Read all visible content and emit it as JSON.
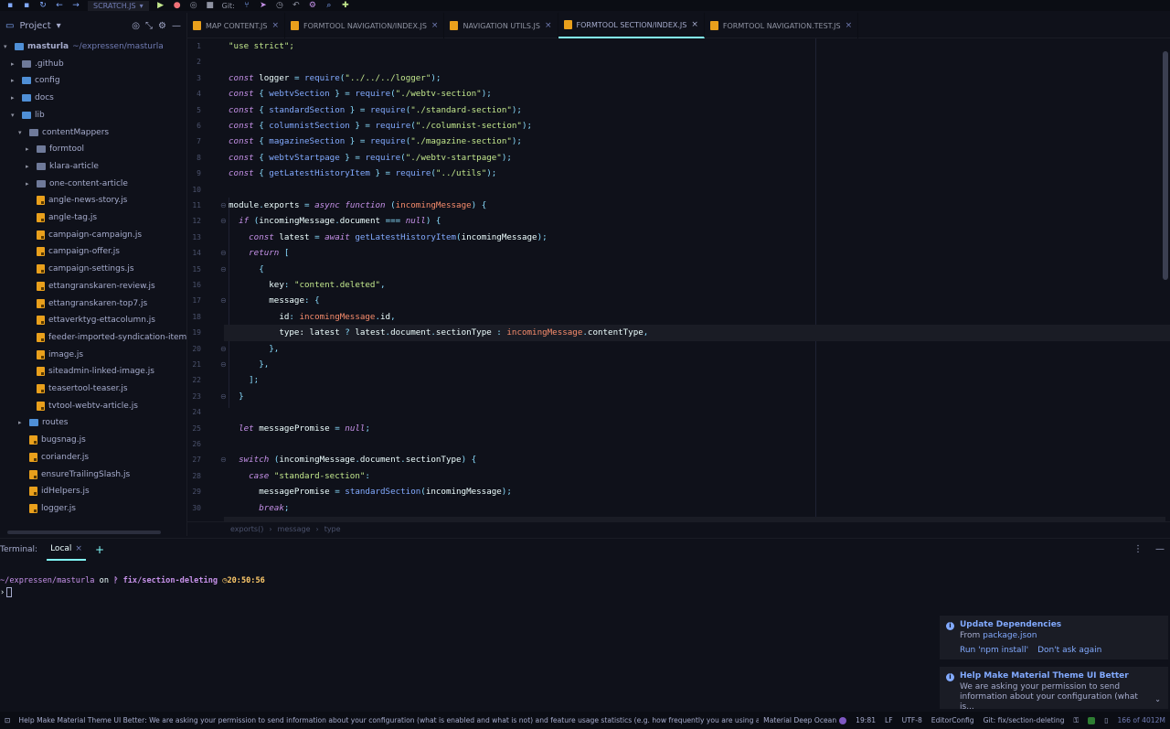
{
  "toolbar": {
    "run_config": "SCRATCH.JS",
    "git_label": "Git:"
  },
  "project": {
    "title": "Project",
    "tree": [
      {
        "label": "masturla",
        "suffix": "~/expressen/masturla",
        "type": "root",
        "depth": 0,
        "expanded": true
      },
      {
        "label": ".github",
        "type": "folder",
        "depth": 1,
        "expanded": false
      },
      {
        "label": "config",
        "type": "folder-blue",
        "depth": 1,
        "expanded": false
      },
      {
        "label": "docs",
        "type": "folder-blue",
        "depth": 1,
        "expanded": false
      },
      {
        "label": "lib",
        "type": "folder-blue",
        "depth": 1,
        "expanded": true
      },
      {
        "label": "contentMappers",
        "type": "folder",
        "depth": 2,
        "expanded": true
      },
      {
        "label": "formtool",
        "type": "folder",
        "depth": 3,
        "expanded": false
      },
      {
        "label": "klara-article",
        "type": "folder",
        "depth": 3,
        "expanded": false
      },
      {
        "label": "one-content-article",
        "type": "folder",
        "depth": 3,
        "expanded": false
      },
      {
        "label": "angle-news-story.js",
        "type": "js",
        "depth": 3
      },
      {
        "label": "angle-tag.js",
        "type": "js",
        "depth": 3
      },
      {
        "label": "campaign-campaign.js",
        "type": "js",
        "depth": 3
      },
      {
        "label": "campaign-offer.js",
        "type": "js",
        "depth": 3
      },
      {
        "label": "campaign-settings.js",
        "type": "js",
        "depth": 3
      },
      {
        "label": "ettangranskaren-review.js",
        "type": "js",
        "depth": 3
      },
      {
        "label": "ettangranskaren-top7.js",
        "type": "js",
        "depth": 3
      },
      {
        "label": "ettaverktyg-ettacolumn.js",
        "type": "js",
        "depth": 3
      },
      {
        "label": "feeder-imported-syndication-item.js",
        "type": "js",
        "depth": 3
      },
      {
        "label": "image.js",
        "type": "js",
        "depth": 3
      },
      {
        "label": "siteadmin-linked-image.js",
        "type": "js",
        "depth": 3
      },
      {
        "label": "teasertool-teaser.js",
        "type": "js",
        "depth": 3
      },
      {
        "label": "tvtool-webtv-article.js",
        "type": "js",
        "depth": 3
      },
      {
        "label": "routes",
        "type": "folder-blue",
        "depth": 2,
        "expanded": false
      },
      {
        "label": "bugsnag.js",
        "type": "js",
        "depth": 2
      },
      {
        "label": "coriander.js",
        "type": "js",
        "depth": 2
      },
      {
        "label": "ensureTrailingSlash.js",
        "type": "js",
        "depth": 2
      },
      {
        "label": "idHelpers.js",
        "type": "js",
        "depth": 2
      },
      {
        "label": "logger.js",
        "type": "js",
        "depth": 2
      }
    ]
  },
  "tabs": [
    {
      "label": "MAP CONTENT.JS",
      "active": false
    },
    {
      "label": "FORMTOOL NAVIGATION/INDEX.JS",
      "active": false
    },
    {
      "label": "NAVIGATION UTILS.JS",
      "active": false
    },
    {
      "label": "FORMTOOL SECTION/INDEX.JS",
      "active": true
    },
    {
      "label": "FORMTOOL NAVIGATION.TEST.JS",
      "active": false
    }
  ],
  "editor": {
    "highlighted_line": 19,
    "lines": [
      [
        [
          "\"use strict\";",
          "str"
        ]
      ],
      [],
      [
        [
          "const",
          "kw"
        ],
        [
          " logger ",
          "plain"
        ],
        [
          "=",
          "op"
        ],
        [
          " ",
          "plain"
        ],
        [
          "require",
          "fn"
        ],
        [
          "(",
          "punc"
        ],
        [
          "\"../../../logger\"",
          "str"
        ],
        [
          ");",
          "punc"
        ]
      ],
      [
        [
          "const",
          "kw"
        ],
        [
          " { ",
          "punc"
        ],
        [
          "webtvSection",
          "fn"
        ],
        [
          " } ",
          "punc"
        ],
        [
          "=",
          "op"
        ],
        [
          " ",
          "plain"
        ],
        [
          "require",
          "fn"
        ],
        [
          "(",
          "punc"
        ],
        [
          "\"./webtv-section\"",
          "str"
        ],
        [
          ");",
          "punc"
        ]
      ],
      [
        [
          "const",
          "kw"
        ],
        [
          " { ",
          "punc"
        ],
        [
          "standardSection",
          "fn"
        ],
        [
          " } ",
          "punc"
        ],
        [
          "=",
          "op"
        ],
        [
          " ",
          "plain"
        ],
        [
          "require",
          "fn"
        ],
        [
          "(",
          "punc"
        ],
        [
          "\"./standard-section\"",
          "str"
        ],
        [
          ");",
          "punc"
        ]
      ],
      [
        [
          "const",
          "kw"
        ],
        [
          " { ",
          "punc"
        ],
        [
          "columnistSection",
          "fn"
        ],
        [
          " } ",
          "punc"
        ],
        [
          "=",
          "op"
        ],
        [
          " ",
          "plain"
        ],
        [
          "require",
          "fn"
        ],
        [
          "(",
          "punc"
        ],
        [
          "\"./columnist-section\"",
          "str"
        ],
        [
          ");",
          "punc"
        ]
      ],
      [
        [
          "const",
          "kw"
        ],
        [
          " { ",
          "punc"
        ],
        [
          "magazineSection",
          "fn"
        ],
        [
          " } ",
          "punc"
        ],
        [
          "=",
          "op"
        ],
        [
          " ",
          "plain"
        ],
        [
          "require",
          "fn"
        ],
        [
          "(",
          "punc"
        ],
        [
          "\"./magazine-section\"",
          "str"
        ],
        [
          ");",
          "punc"
        ]
      ],
      [
        [
          "const",
          "kw"
        ],
        [
          " { ",
          "punc"
        ],
        [
          "webtvStartpage",
          "fn"
        ],
        [
          " } ",
          "punc"
        ],
        [
          "=",
          "op"
        ],
        [
          " ",
          "plain"
        ],
        [
          "require",
          "fn"
        ],
        [
          "(",
          "punc"
        ],
        [
          "\"./webtv-startpage\"",
          "str"
        ],
        [
          ");",
          "punc"
        ]
      ],
      [
        [
          "const",
          "kw"
        ],
        [
          " { ",
          "punc"
        ],
        [
          "getLatestHistoryItem",
          "fn"
        ],
        [
          " } ",
          "punc"
        ],
        [
          "=",
          "op"
        ],
        [
          " ",
          "plain"
        ],
        [
          "require",
          "fn"
        ],
        [
          "(",
          "punc"
        ],
        [
          "\"../utils\"",
          "str"
        ],
        [
          ");",
          "punc"
        ]
      ],
      [],
      [
        [
          "module",
          "plain"
        ],
        [
          ".",
          "punc"
        ],
        [
          "exports",
          "plain"
        ],
        [
          " = ",
          "op"
        ],
        [
          "async",
          "kw"
        ],
        [
          " ",
          "plain"
        ],
        [
          "function",
          "kw"
        ],
        [
          " (",
          "punc"
        ],
        [
          "incomingMessage",
          "var"
        ],
        [
          ") {",
          "punc"
        ]
      ],
      [
        [
          "  ",
          "plain"
        ],
        [
          "if",
          "kw"
        ],
        [
          " (",
          "punc"
        ],
        [
          "incomingMessage",
          "plain"
        ],
        [
          ".",
          "punc"
        ],
        [
          "document",
          "plain"
        ],
        [
          " === ",
          "op"
        ],
        [
          "null",
          "kw"
        ],
        [
          ") {",
          "punc"
        ]
      ],
      [
        [
          "    ",
          "plain"
        ],
        [
          "const",
          "kw"
        ],
        [
          " latest ",
          "plain"
        ],
        [
          "=",
          "op"
        ],
        [
          " ",
          "plain"
        ],
        [
          "await",
          "kw"
        ],
        [
          " ",
          "plain"
        ],
        [
          "getLatestHistoryItem",
          "fn"
        ],
        [
          "(",
          "punc"
        ],
        [
          "incomingMessage",
          "plain"
        ],
        [
          ");",
          "punc"
        ]
      ],
      [
        [
          "    ",
          "plain"
        ],
        [
          "return",
          "kw"
        ],
        [
          " [",
          "punc"
        ]
      ],
      [
        [
          "      ",
          "plain"
        ],
        [
          "{",
          "punc"
        ]
      ],
      [
        [
          "        ",
          "plain"
        ],
        [
          "key",
          "plain"
        ],
        [
          ": ",
          "punc"
        ],
        [
          "\"content.deleted\"",
          "str"
        ],
        [
          ",",
          "punc"
        ]
      ],
      [
        [
          "        ",
          "plain"
        ],
        [
          "message",
          "plain"
        ],
        [
          ": {",
          "punc"
        ]
      ],
      [
        [
          "          ",
          "plain"
        ],
        [
          "id",
          "plain"
        ],
        [
          ": ",
          "punc"
        ],
        [
          "incomingMessage",
          "var"
        ],
        [
          ".",
          "punc"
        ],
        [
          "id",
          "plain"
        ],
        [
          ",",
          "punc"
        ]
      ],
      [
        [
          "          ",
          "plain"
        ],
        [
          "type",
          "plain"
        ],
        [
          ": latest ",
          "plain"
        ],
        [
          "?",
          "op"
        ],
        [
          " latest",
          "plain"
        ],
        [
          ".",
          "punc"
        ],
        [
          "document",
          "plain"
        ],
        [
          ".",
          "punc"
        ],
        [
          "sectionType",
          "plain"
        ],
        [
          " : ",
          "op"
        ],
        [
          "incomingMessage",
          "var"
        ],
        [
          ".",
          "punc"
        ],
        [
          "contentType",
          "plain"
        ],
        [
          ",",
          "punc"
        ]
      ],
      [
        [
          "        ",
          "plain"
        ],
        [
          "},",
          "punc"
        ]
      ],
      [
        [
          "      ",
          "plain"
        ],
        [
          "},",
          "punc"
        ]
      ],
      [
        [
          "    ",
          "plain"
        ],
        [
          "];",
          "punc"
        ]
      ],
      [
        [
          "  ",
          "plain"
        ],
        [
          "}",
          "punc"
        ]
      ],
      [],
      [
        [
          "  ",
          "plain"
        ],
        [
          "let",
          "kw"
        ],
        [
          " messagePromise ",
          "plain"
        ],
        [
          "=",
          "op"
        ],
        [
          " ",
          "plain"
        ],
        [
          "null",
          "kw"
        ],
        [
          ";",
          "punc"
        ]
      ],
      [],
      [
        [
          "  ",
          "plain"
        ],
        [
          "switch",
          "kw"
        ],
        [
          " (",
          "punc"
        ],
        [
          "incomingMessage",
          "plain"
        ],
        [
          ".",
          "punc"
        ],
        [
          "document",
          "plain"
        ],
        [
          ".",
          "punc"
        ],
        [
          "sectionType",
          "plain"
        ],
        [
          ") {",
          "punc"
        ]
      ],
      [
        [
          "    ",
          "plain"
        ],
        [
          "case",
          "kw"
        ],
        [
          " ",
          "plain"
        ],
        [
          "\"standard-section\"",
          "str"
        ],
        [
          ":",
          "punc"
        ]
      ],
      [
        [
          "      ",
          "plain"
        ],
        [
          "messagePromise ",
          "plain"
        ],
        [
          "=",
          "op"
        ],
        [
          " ",
          "plain"
        ],
        [
          "standardSection",
          "fn"
        ],
        [
          "(",
          "punc"
        ],
        [
          "incomingMessage",
          "plain"
        ],
        [
          ");",
          "punc"
        ]
      ],
      [
        [
          "      ",
          "plain"
        ],
        [
          "break",
          "kw"
        ],
        [
          ";",
          "punc"
        ]
      ]
    ]
  },
  "breadcrumb": [
    "exports()",
    "message",
    "type"
  ],
  "terminal": {
    "label": "Terminal:",
    "tab": "Local",
    "prompt_path": "~/expressen/masturla",
    "prompt_on": "on",
    "prompt_branch": "fix/section-deleting",
    "prompt_time": "20:50:56"
  },
  "notifications": [
    {
      "title": "Update Dependencies",
      "body_prefix": "From ",
      "body_link": "package.json",
      "action1": "Run 'npm install'",
      "action2": "Don't ask again"
    },
    {
      "title": "Help Make Material Theme UI Better",
      "body": "We are asking your permission to send information about your configuration (what is..."
    }
  ],
  "status": {
    "message": "Help Make Material Theme UI Better: We are asking your permission to send information about your configuration (what is enabled and what is not) and feature usage statistics (e.g. how frequently you are using a feature). This da...",
    "theme": "Material Deep Ocean",
    "position": "19:81",
    "line_ending": "LF",
    "encoding": "UTF-8",
    "editorconfig": "EditorConfig",
    "git": "Git: fix/section-deleting",
    "memory": "166 of 4012M"
  },
  "colors": {
    "background": "#0f111a",
    "accent": "#84ffff",
    "string": "#c3e88d",
    "keyword": "#c792ea",
    "function": "#82aaff"
  }
}
